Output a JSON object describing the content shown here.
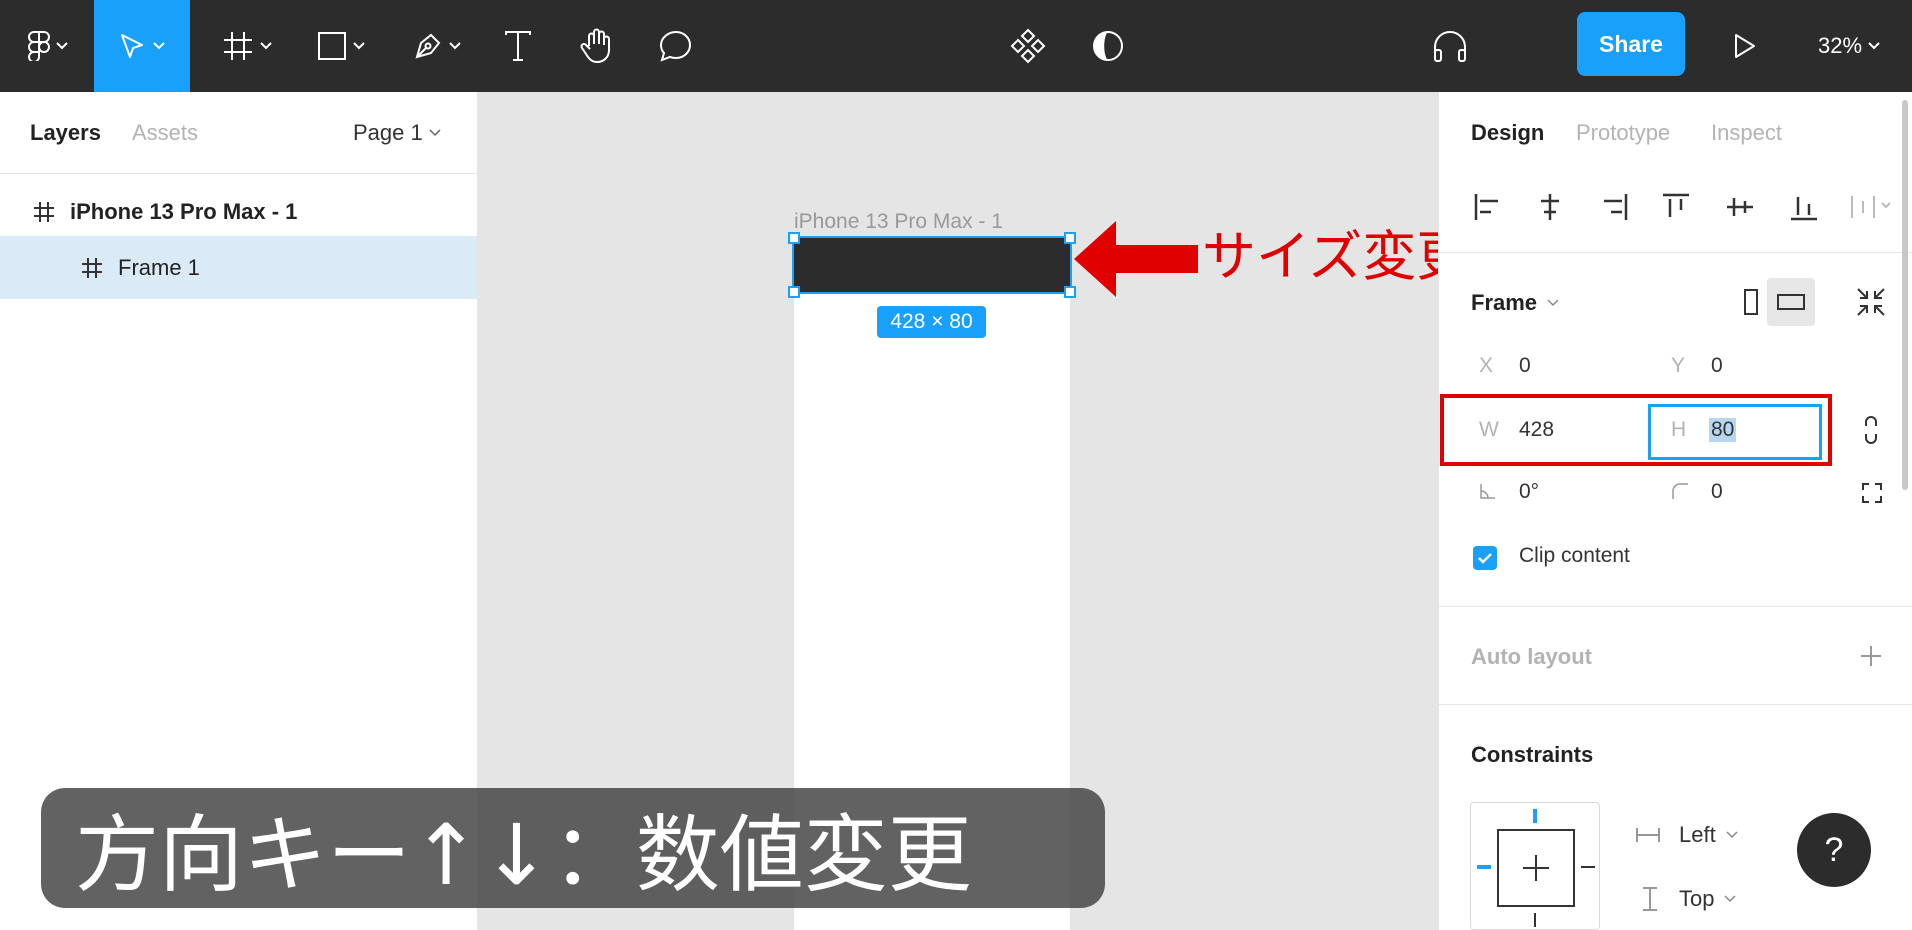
{
  "toolbar": {
    "icons": [
      "figma-menu-icon",
      "move-tool-icon",
      "frame-tool-icon",
      "rectangle-tool-icon",
      "pen-tool-icon",
      "text-tool-icon",
      "hand-tool-icon",
      "comment-tool-icon",
      "components-icon",
      "mask-icon",
      "audio-icon",
      "play-icon"
    ],
    "share_label": "Share",
    "zoom": "32%"
  },
  "left_panel": {
    "tabs": [
      "Layers",
      "Assets"
    ],
    "page_label": "Page 1",
    "layers": [
      {
        "label": "iPhone 13 Pro Max - 1"
      },
      {
        "label": "Frame 1",
        "selected": true
      }
    ]
  },
  "canvas": {
    "frame_label": "iPhone 13 Pro Max - 1",
    "size_badge": "428 × 80",
    "annotation": "サイズ変更"
  },
  "right_panel": {
    "tabs": [
      "Design",
      "Prototype",
      "Inspect"
    ],
    "frame_section": {
      "label": "Frame",
      "x_label": "X",
      "x_value": "0",
      "y_label": "Y",
      "y_value": "0",
      "w_label": "W",
      "w_value": "428",
      "h_label": "H",
      "h_value": "80",
      "rotation": "0°",
      "radius": "0",
      "clip_content_label": "Clip content",
      "clip_content_checked": true
    },
    "auto_layout_label": "Auto layout",
    "constraints": {
      "label": "Constraints",
      "horizontal": "Left",
      "vertical": "Top"
    },
    "help_label": "?"
  },
  "caption": "方向キー↑↓：数値変更",
  "colors": {
    "toolbar_bg": "#2c2c2c",
    "accent": "#18a0fb",
    "annotation_red": "#e00000",
    "selected_layer_bg": "#daebf7"
  }
}
